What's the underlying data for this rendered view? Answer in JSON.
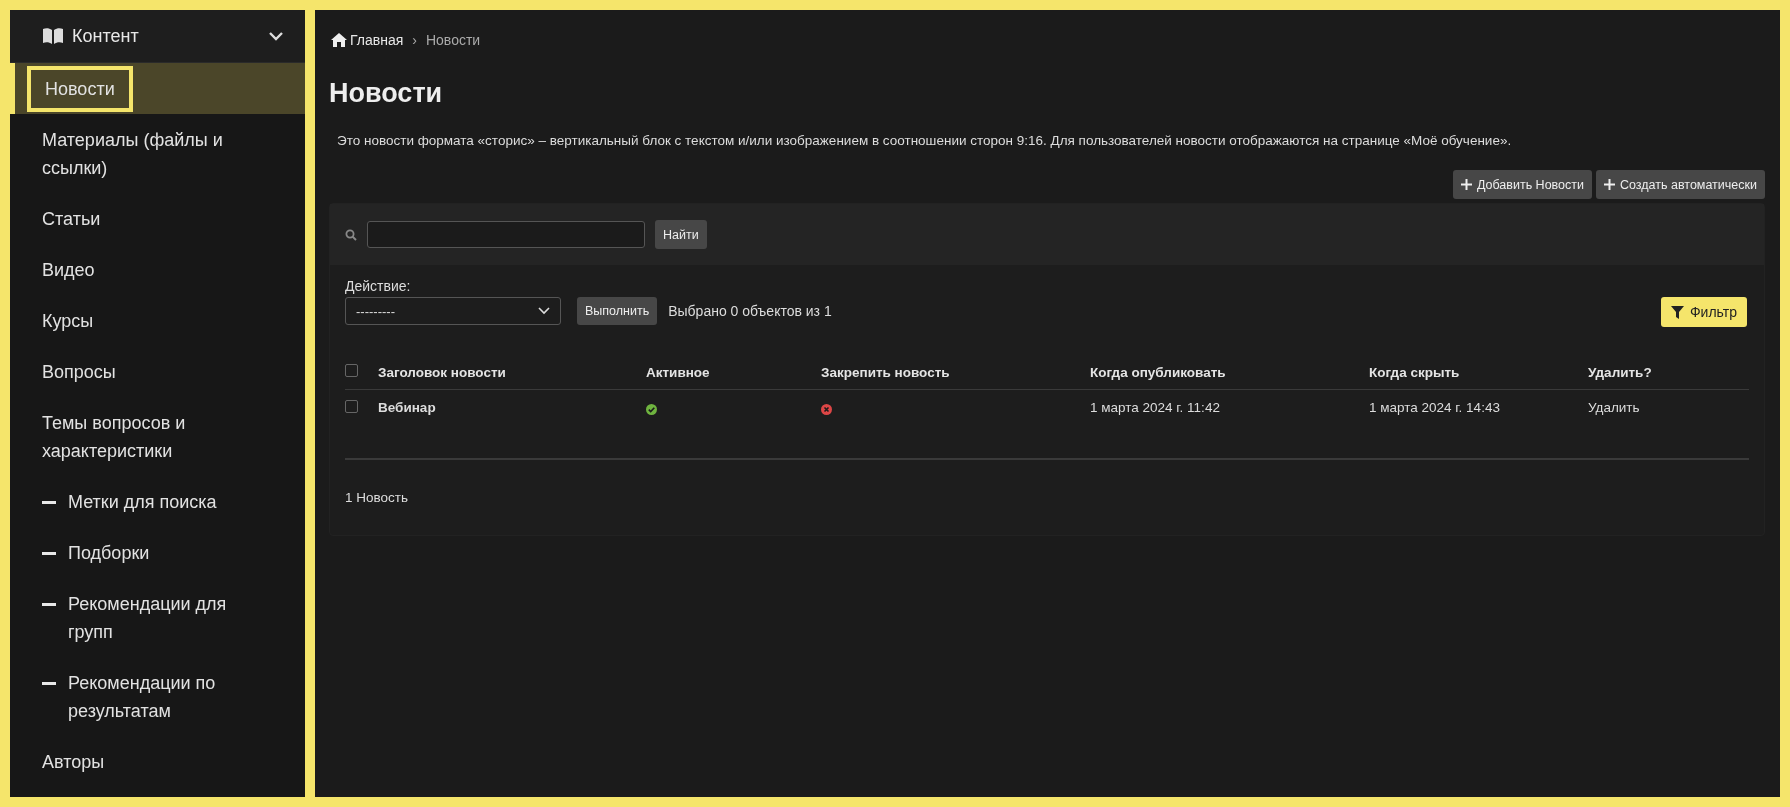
{
  "sidebar": {
    "section": {
      "label": "Контент",
      "expanded": true
    },
    "items": [
      {
        "label": "Новости",
        "kind": "item",
        "selected": true
      },
      {
        "label": "Материалы (файлы и ссылки)",
        "kind": "item",
        "selected": false
      },
      {
        "label": "Статьи",
        "kind": "item",
        "selected": false
      },
      {
        "label": "Видео",
        "kind": "item",
        "selected": false
      },
      {
        "label": "Курсы",
        "kind": "item",
        "selected": false
      },
      {
        "label": "Вопросы",
        "kind": "item",
        "selected": false
      },
      {
        "label": "Темы вопросов и характеристики",
        "kind": "item",
        "selected": false
      },
      {
        "label": "Метки для поиска",
        "kind": "subitem",
        "selected": false
      },
      {
        "label": "Подборки",
        "kind": "subitem",
        "selected": false
      },
      {
        "label": "Рекомендации для групп",
        "kind": "subitem",
        "selected": false
      },
      {
        "label": "Рекомендации по результатам",
        "kind": "subitem",
        "selected": false
      },
      {
        "label": "Авторы",
        "kind": "item",
        "selected": false
      }
    ]
  },
  "breadcrumbs": [
    "Главная",
    "›",
    "Новости"
  ],
  "title": "Новости",
  "description": "Это новости формата «сторис» – вертикальный блок с текстом и/или изображением в соотношении сторон 9:16. Для пользователей новости отображаются на странице «Моё обучение».",
  "toolbar_buttons": [
    "Добавить Новости",
    "Создать автоматически"
  ],
  "search": {
    "button": "Найти"
  },
  "actions": {
    "label": "Действие:",
    "value": "---------",
    "button": "Выполнить",
    "selection": "Выбрано 0 объектов из 1"
  },
  "filter_button": "Фильтр",
  "table": {
    "select_all": {
      "checked": false
    },
    "columns": [
      "Заголовок новости",
      "Активное",
      "Закрепить новость",
      "Когда опубликовать",
      "Когда скрыть",
      "Удалить?"
    ],
    "rows": [
      {
        "checked": false,
        "title": "Вебинар",
        "active": true,
        "pinned": false,
        "publish": "1 марта 2024 г. 11:42",
        "hide": "1 марта 2024 г. 14:43",
        "delete": "Удалить"
      }
    ]
  },
  "footer": "1 Новость"
}
